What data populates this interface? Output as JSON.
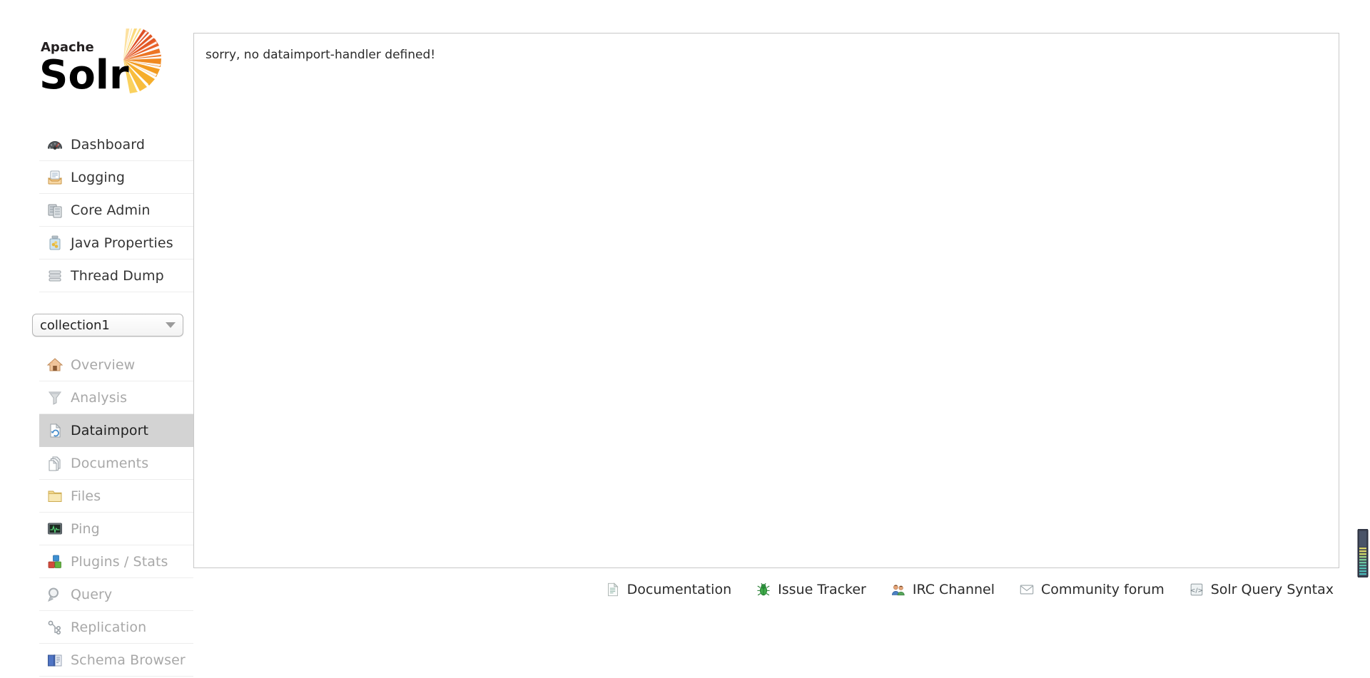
{
  "logo": {
    "top_text": "Apache",
    "main_text": "Solr",
    "alt": "apache-solr-logo"
  },
  "sidebar": {
    "top_items": [
      {
        "label": "Dashboard",
        "icon": "dashboard-icon",
        "name": "sidebar-item-dashboard",
        "disabled": false,
        "active": false
      },
      {
        "label": "Logging",
        "icon": "logging-icon",
        "name": "sidebar-item-logging",
        "disabled": false,
        "active": false
      },
      {
        "label": "Core Admin",
        "icon": "core-admin-icon",
        "name": "sidebar-item-core-admin",
        "disabled": false,
        "active": false
      },
      {
        "label": "Java Properties",
        "icon": "java-properties-icon",
        "name": "sidebar-item-java-properties",
        "disabled": false,
        "active": false
      },
      {
        "label": "Thread Dump",
        "icon": "thread-dump-icon",
        "name": "sidebar-item-thread-dump",
        "disabled": false,
        "active": false
      }
    ],
    "core_selector": {
      "selected": "collection1",
      "caret_icon": "chevron-down-icon"
    },
    "core_items": [
      {
        "label": "Overview",
        "icon": "overview-home-icon",
        "name": "sidebar-item-overview",
        "disabled": true,
        "active": false
      },
      {
        "label": "Analysis",
        "icon": "analysis-funnel-icon",
        "name": "sidebar-item-analysis",
        "disabled": true,
        "active": false
      },
      {
        "label": "Dataimport",
        "icon": "dataimport-icon",
        "name": "sidebar-item-dataimport",
        "disabled": false,
        "active": true
      },
      {
        "label": "Documents",
        "icon": "documents-icon",
        "name": "sidebar-item-documents",
        "disabled": true,
        "active": false
      },
      {
        "label": "Files",
        "icon": "files-folder-icon",
        "name": "sidebar-item-files",
        "disabled": true,
        "active": false
      },
      {
        "label": "Ping",
        "icon": "ping-monitor-icon",
        "name": "sidebar-item-ping",
        "disabled": true,
        "active": false
      },
      {
        "label": "Plugins / Stats",
        "icon": "plugins-blocks-icon",
        "name": "sidebar-item-plugins-stats",
        "disabled": true,
        "active": false
      },
      {
        "label": "Query",
        "icon": "query-magnifier-icon",
        "name": "sidebar-item-query",
        "disabled": true,
        "active": false
      },
      {
        "label": "Replication",
        "icon": "replication-icon",
        "name": "sidebar-item-replication",
        "disabled": true,
        "active": false
      },
      {
        "label": "Schema Browser",
        "icon": "schema-book-icon",
        "name": "sidebar-item-schema-browser",
        "disabled": true,
        "active": false
      }
    ]
  },
  "content": {
    "message": "sorry, no dataimport-handler defined!"
  },
  "footer": {
    "links": [
      {
        "label": "Documentation",
        "icon": "document-page-icon",
        "name": "footer-link-documentation"
      },
      {
        "label": "Issue Tracker",
        "icon": "bug-icon",
        "name": "footer-link-issue-tracker"
      },
      {
        "label": "IRC Channel",
        "icon": "people-group-icon",
        "name": "footer-link-irc-channel"
      },
      {
        "label": "Community forum",
        "icon": "envelope-icon",
        "name": "footer-link-community-forum"
      },
      {
        "label": "Solr Query Syntax",
        "icon": "code-brackets-icon",
        "name": "footer-link-solr-query-syntax"
      }
    ]
  },
  "colors": {
    "active_nav_bg": "#d3d3d3",
    "panel_border": "#c8c8c8",
    "divider": "#ededed",
    "text": "#333333",
    "text_disabled": "#a8a8a8",
    "solr_orange": "#e8622a",
    "solr_yellow": "#f5c13a"
  }
}
